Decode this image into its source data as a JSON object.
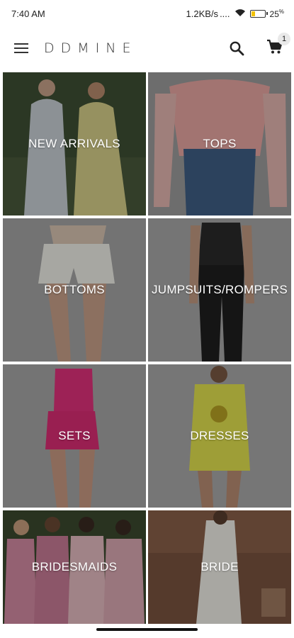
{
  "status_bar": {
    "time": "7:40 AM",
    "network_speed": "1.2KB/s",
    "signal_dots": "....",
    "battery_percent": "25",
    "battery_sup": "%",
    "icons": [
      "wifi-icon",
      "battery-icon"
    ]
  },
  "header": {
    "brand": "DDMINE",
    "cart_count": "1",
    "icons": [
      "hamburger-menu-icon",
      "search-icon",
      "cart-icon"
    ]
  },
  "categories": [
    {
      "label": "NEW ARRIVALS"
    },
    {
      "label": "TOPS"
    },
    {
      "label": "BOTTOMS"
    },
    {
      "label": "JUMPSUITS/ROMPERS"
    },
    {
      "label": "SETS"
    },
    {
      "label": "DRESSES"
    },
    {
      "label": "BRIDESMAIDS"
    },
    {
      "label": "BRIDE"
    }
  ],
  "colors": {
    "overlay": "#000000",
    "badge_bg": "#e9e9e9"
  }
}
